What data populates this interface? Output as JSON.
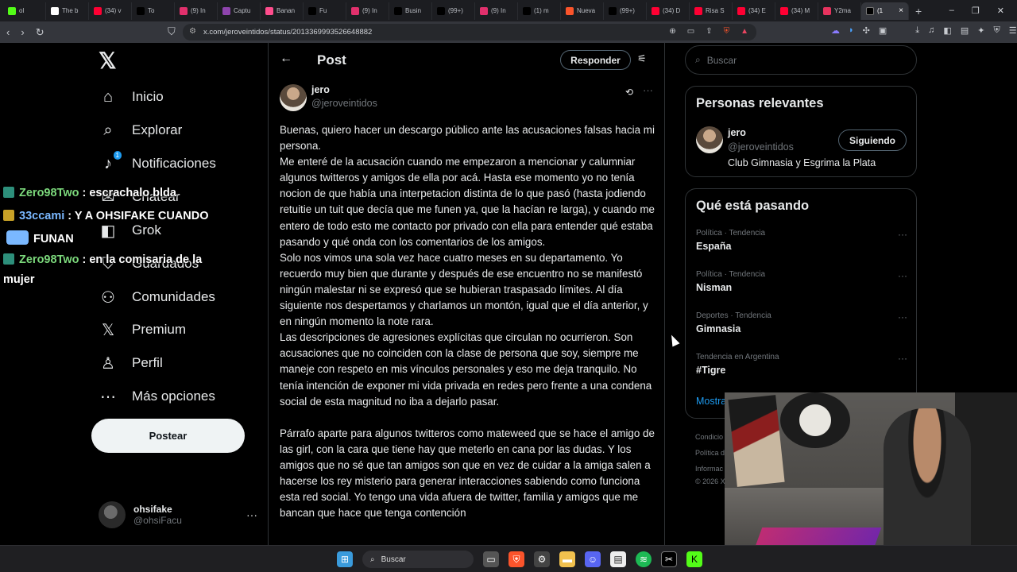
{
  "browser": {
    "tabs": [
      {
        "label": "ol",
        "color": "#53fc18"
      },
      {
        "label": "The b",
        "color": "#ffffff"
      },
      {
        "label": "(34) v",
        "color": "#ff0033"
      },
      {
        "label": "To",
        "color": "#000000"
      },
      {
        "label": "(9) In",
        "color": "#e1306c"
      },
      {
        "label": "Captu",
        "color": "#8e44ad"
      },
      {
        "label": "Banan",
        "color": "#ff4d8d"
      },
      {
        "label": "Fu",
        "color": "#000000"
      },
      {
        "label": "(9) In",
        "color": "#e1306c"
      },
      {
        "label": "Busin",
        "color": "#000000"
      },
      {
        "label": "(99+)",
        "color": "#000000"
      },
      {
        "label": "(9) In",
        "color": "#e1306c"
      },
      {
        "label": "(1) m",
        "color": "#000000"
      },
      {
        "label": "Nueva",
        "color": "#fb542b"
      },
      {
        "label": "(99+)",
        "color": "#000000"
      },
      {
        "label": "(34) D",
        "color": "#ff0033"
      },
      {
        "label": "Risa S",
        "color": "#ff0033"
      },
      {
        "label": "(34) E",
        "color": "#ff0033"
      },
      {
        "label": "(34) M",
        "color": "#ff0033"
      },
      {
        "label": "Y2ma",
        "color": "#e7335e"
      }
    ],
    "active_tab": {
      "label": "(1",
      "close": "×"
    },
    "new_tab": "+",
    "window_controls": [
      "–",
      "❐",
      "✕"
    ],
    "url": "x.com/jeroveintidos/status/2013369993526648882"
  },
  "nav": {
    "items": [
      {
        "id": "home",
        "label": "Inicio",
        "icon": "home-icon",
        "glyph": "⌂"
      },
      {
        "id": "explore",
        "label": "Explorar",
        "icon": "search-icon",
        "glyph": "⌕"
      },
      {
        "id": "notifications",
        "label": "Notificaciones",
        "icon": "bell-icon",
        "glyph": "♪",
        "badge": "1"
      },
      {
        "id": "chat",
        "label": "Chatear",
        "icon": "chat-icon",
        "glyph": "✉"
      },
      {
        "id": "grok",
        "label": "Grok",
        "icon": "grok-icon",
        "glyph": "◧"
      },
      {
        "id": "bookmarks",
        "label": "Guardados",
        "icon": "bookmark-icon",
        "glyph": "⛉"
      },
      {
        "id": "communities",
        "label": "Comunidades",
        "icon": "communities-icon",
        "glyph": "⚇"
      },
      {
        "id": "premium",
        "label": "Premium",
        "icon": "x-icon",
        "glyph": "𝕏"
      },
      {
        "id": "profile",
        "label": "Perfil",
        "icon": "person-icon",
        "glyph": "♙"
      },
      {
        "id": "more",
        "label": "Más opciones",
        "icon": "more-circle-icon",
        "glyph": "⋯"
      }
    ],
    "post_button": "Postear",
    "account": {
      "name": "ohsifake",
      "handle": "@ohsiFacu",
      "more": "···"
    }
  },
  "main": {
    "title": "Post",
    "reply_button": "Responder",
    "author": {
      "name": "jero",
      "handle": "@jeroveintidos"
    },
    "paragraphs": [
      "Buenas, quiero hacer un descargo público ante las acusaciones falsas hacia mi persona.",
      "Me enteré de la acusación cuando me empezaron a mencionar y calumniar algunos twitteros y amigos de ella por acá. Hasta ese momento yo no tenía nocion de que había una interpetacion distinta de lo que pasó (hasta jodiendo retuitie un tuit que decía que me funen ya, que la hacían re larga), y cuando me entero de todo esto me contacto por privado con ella para entender qué estaba pasando y qué onda con los comentarios de los amigos.",
      "Solo nos vimos una sola vez hace cuatro meses en su departamento. Yo recuerdo muy bien que durante y después de ese encuentro no se manifestó ningún malestar ni se expresó que se hubieran traspasado límites. Al día siguiente nos despertamos y charlamos un montón, igual que el día anterior, y en ningún momento la note rara.",
      "Las descripciones de agresiones explícitas que circulan no ocurrieron. Son acusaciones que no coinciden con la clase de persona que soy, siempre me maneje con respeto en mis vínculos personales y eso me deja tranquilo. No tenía intención de exponer mi vida privada en redes pero frente a una condena social de esta magnitud no iba a dejarlo pasar.",
      "Párrafo aparte para algunos twitteros como mateweed que se hace el amigo de las girl, con la cara que tiene hay que meterlo en cana por las dudas. Y los amigos que no sé que tan amigos son que en vez de cuidar a la amiga salen a hacerse los rey misterio para generar interacciones sabiendo como funciona esta red social. Yo tengo una vida afuera de twitter, familia y amigos que me bancan que hace que tenga contención"
    ]
  },
  "sidebar": {
    "search_placeholder": "Buscar",
    "relevant": {
      "title": "Personas relevantes",
      "name": "jero",
      "handle": "@jeroveintidos",
      "bio": "Club Gimnasia y Esgrima la Plata",
      "follow_button": "Siguiendo"
    },
    "trending": {
      "title": "Qué está pasando",
      "items": [
        {
          "meta": "Política · Tendencia",
          "name": "España"
        },
        {
          "meta": "Política · Tendencia",
          "name": "Nisman"
        },
        {
          "meta": "Deportes · Tendencia",
          "name": "Gimnasia"
        },
        {
          "meta": "Tendencia en Argentina",
          "name": "#Tigre"
        }
      ],
      "show_more": "Mostrar más"
    },
    "footer": [
      "Condicio",
      "Política d",
      "Informac",
      "© 2026 X"
    ]
  },
  "chat": [
    {
      "user": "Zero98Two",
      "message": ": escrachalo blda",
      "badge": "gift"
    },
    {
      "user": "33ccami",
      "message": ": Y A OHSIFAKE CUANDO",
      "message2": "FUNAN",
      "badge": "crown"
    },
    {
      "user": "Zero98Two",
      "message": ": en la comisaria de la",
      "message2": "mujer",
      "badge": "gift"
    }
  ],
  "taskbar": {
    "search_label": "Buscar"
  }
}
